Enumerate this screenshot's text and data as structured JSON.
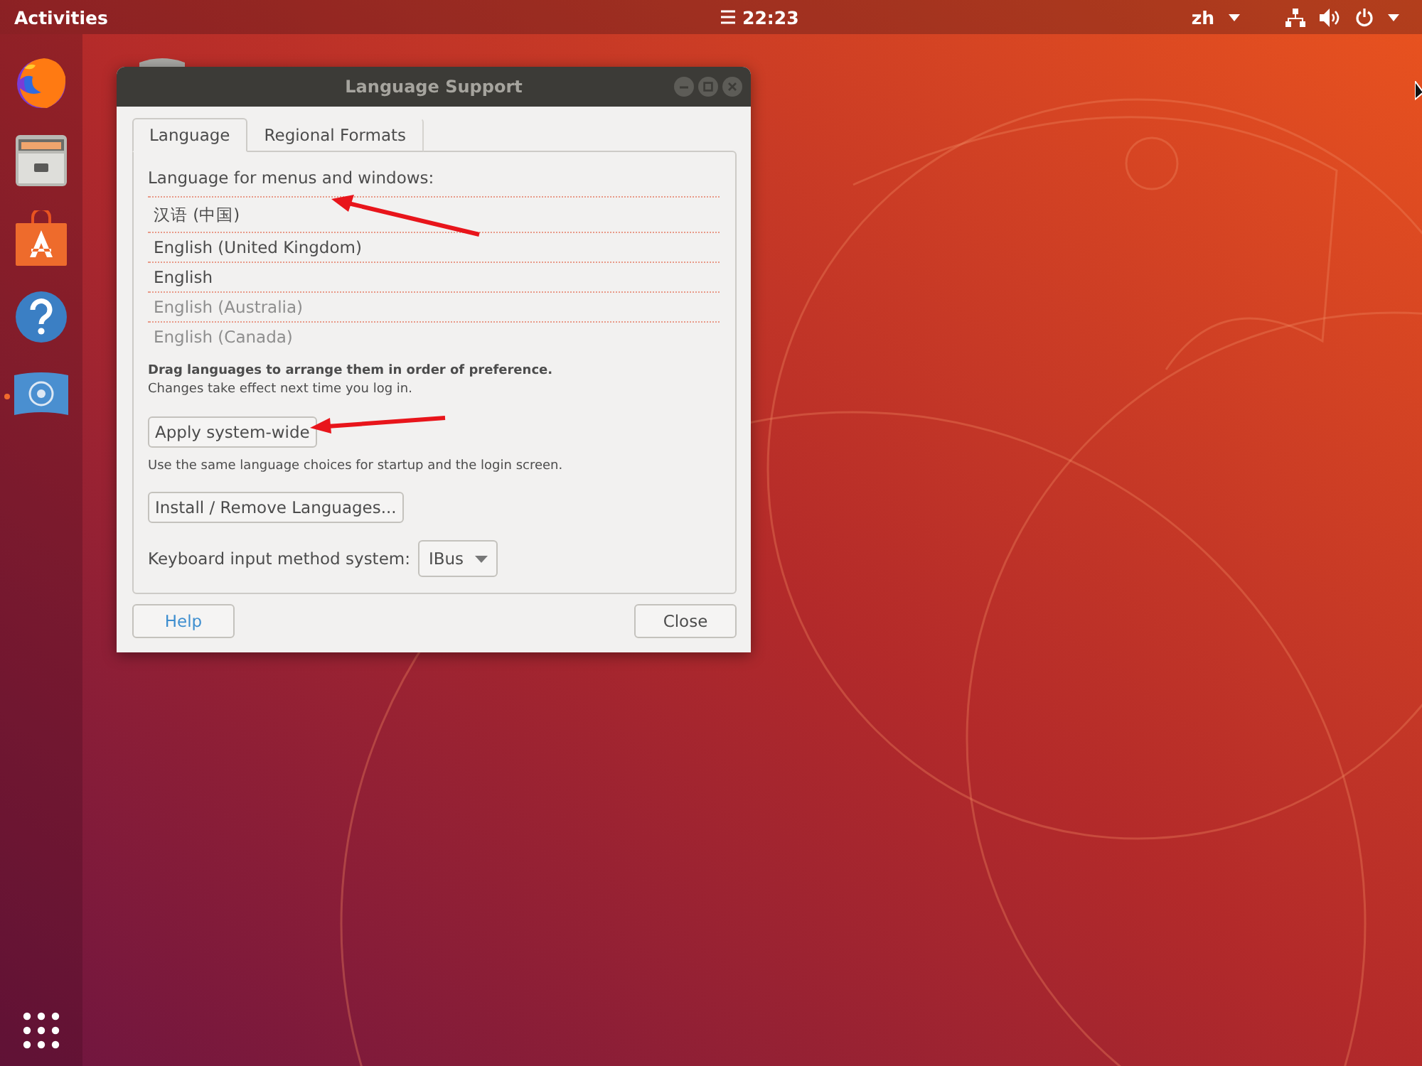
{
  "top_bar": {
    "activities": "Activities",
    "clock": "22:23",
    "input_source": "zh"
  },
  "dock": {
    "items": [
      {
        "kind": "browser",
        "running": false
      },
      {
        "kind": "files",
        "running": false
      },
      {
        "kind": "software",
        "running": false
      },
      {
        "kind": "help",
        "running": false
      },
      {
        "kind": "flag",
        "running": true
      }
    ]
  },
  "window": {
    "title": "Language Support",
    "tabs": [
      {
        "label": "Language",
        "selected": true
      },
      {
        "label": "Regional Formats",
        "selected": false
      }
    ],
    "list_label": "Language for menus and windows:",
    "languages": [
      {
        "name": "汉语 (中国)",
        "dimmed": false
      },
      {
        "name": "English (United Kingdom)",
        "dimmed": false
      },
      {
        "name": "English",
        "dimmed": false
      },
      {
        "name": "English (Australia)",
        "dimmed": true
      },
      {
        "name": "English (Canada)",
        "dimmed": true
      }
    ],
    "drag_hint": "Drag languages to arrange them in order of preference.",
    "drag_note": "Changes take effect next time you log in.",
    "apply_button": "Apply system-wide",
    "apply_note": "Use the same language choices for startup and the login screen.",
    "install_button": "Install / Remove Languages...",
    "input_method_label": "Keyboard input method system:",
    "input_method_value": "IBus",
    "help_button": "Help",
    "close_button": "Close"
  }
}
